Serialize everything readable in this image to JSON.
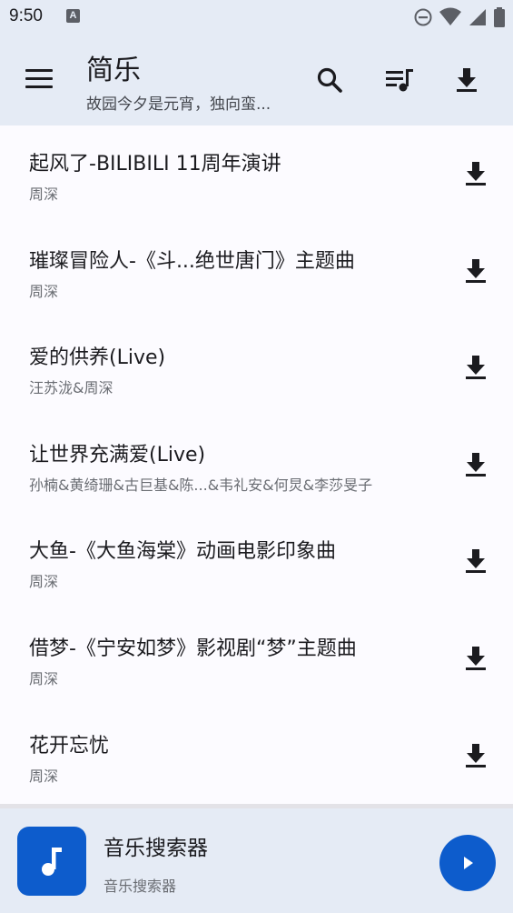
{
  "status_bar": {
    "time": "9:50",
    "notification_icon_letter": "A",
    "icons": [
      "notification-a-icon",
      "do-not-disturb-icon",
      "wifi-icon",
      "cellular-signal-icon",
      "battery-icon"
    ]
  },
  "app_bar": {
    "title": "简乐",
    "subtitle": "故园今夕是元宵，独向蛮...",
    "actions": [
      "menu-icon",
      "search-icon",
      "queue-music-icon",
      "download-icon"
    ]
  },
  "songs": [
    {
      "title": "起风了-BILIBILI 11周年演讲",
      "artist": "周深"
    },
    {
      "title": "璀璨冒险人-《斗...绝世唐门》主题曲",
      "artist": "周深"
    },
    {
      "title": "爱的供养(Live)",
      "artist": "汪苏泷&周深"
    },
    {
      "title": "让世界充满爱(Live)",
      "artist": "孙楠&黄绮珊&古巨基&陈...&韦礼安&何炅&李莎旻子"
    },
    {
      "title": "大鱼-《大鱼海棠》动画电影印象曲",
      "artist": "周深"
    },
    {
      "title": "借梦-《宁安如梦》影视剧“梦”主题曲",
      "artist": "周深"
    },
    {
      "title": "花开忘忧",
      "artist": "周深"
    }
  ],
  "mini_player": {
    "title": "音乐搜索器",
    "subtitle": "音乐搜索器",
    "art_icon": "music-note-icon",
    "play_icon": "play-icon"
  },
  "colors": {
    "app_bar_bg": "#e5ebf5",
    "list_bg": "#fcfbff",
    "accent": "#0d5ccc",
    "primary_text": "#1b1b1f",
    "secondary_text": "#6a6d73"
  }
}
